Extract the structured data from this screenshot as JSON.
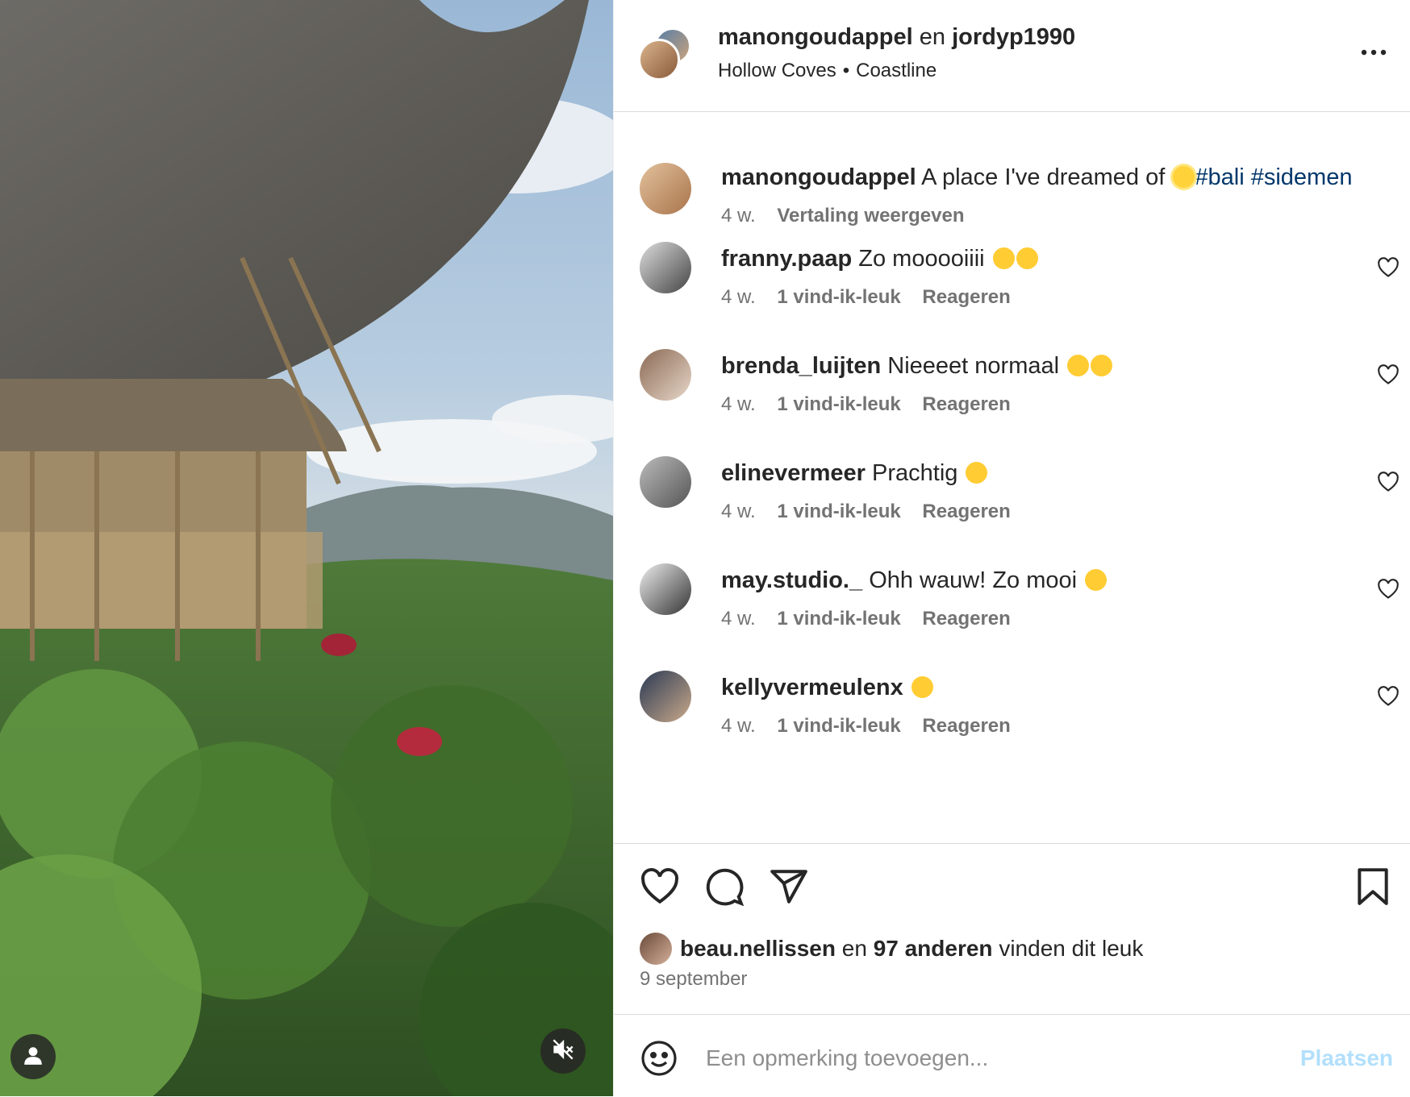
{
  "post": {
    "author": "manongoudappel",
    "conj": "en",
    "coauthor": "jordyp1990",
    "location_1": "Hollow Coves",
    "separator": "•",
    "location_2": "Coastline"
  },
  "caption": {
    "user": "manongoudappel",
    "text": "A place I've dreamed of",
    "hashtags": "#bali #sidemen",
    "time": "4 w.",
    "translate": "Vertaling weergeven"
  },
  "comments": [
    {
      "user": "franny.paap",
      "text": "Zo mooooiiii",
      "time": "4 w.",
      "likes": "1 vind-ik-leuk",
      "reply": "Reageren"
    },
    {
      "user": "brenda_luijten",
      "text": "Nieeeet normaal",
      "time": "4 w.",
      "likes": "1 vind-ik-leuk",
      "reply": "Reageren"
    },
    {
      "user": "elinevermeer",
      "text": "Prachtig",
      "time": "4 w.",
      "likes": "1 vind-ik-leuk",
      "reply": "Reageren"
    },
    {
      "user": "may.studio._",
      "text": "Ohh wauw! Zo mooi",
      "time": "4 w.",
      "likes": "1 vind-ik-leuk",
      "reply": "Reageren"
    },
    {
      "user": "kellyvermeulenx",
      "text": "",
      "time": "4 w.",
      "likes": "1 vind-ik-leuk",
      "reply": "Reageren"
    }
  ],
  "likes": {
    "user": "beau.nellissen",
    "conj": "en",
    "others": "97 anderen",
    "suffix": "vinden dit leuk"
  },
  "date": "9 september",
  "composer": {
    "placeholder": "Een opmerking toevoegen...",
    "post_label": "Plaatsen"
  },
  "icons": {
    "like": "heart-icon",
    "comment": "comment-bubble-icon",
    "share": "paper-plane-icon",
    "save": "bookmark-icon",
    "emoji": "smiley-icon",
    "more": "more-horizontal-icon",
    "mute": "speaker-muted-icon",
    "tagged": "user-icon"
  },
  "colors": {
    "hashtag": "#00376b",
    "muted": "#737373",
    "post_button_disabled": "#b2dffc",
    "emoji_yellow": "#ffcc33"
  }
}
